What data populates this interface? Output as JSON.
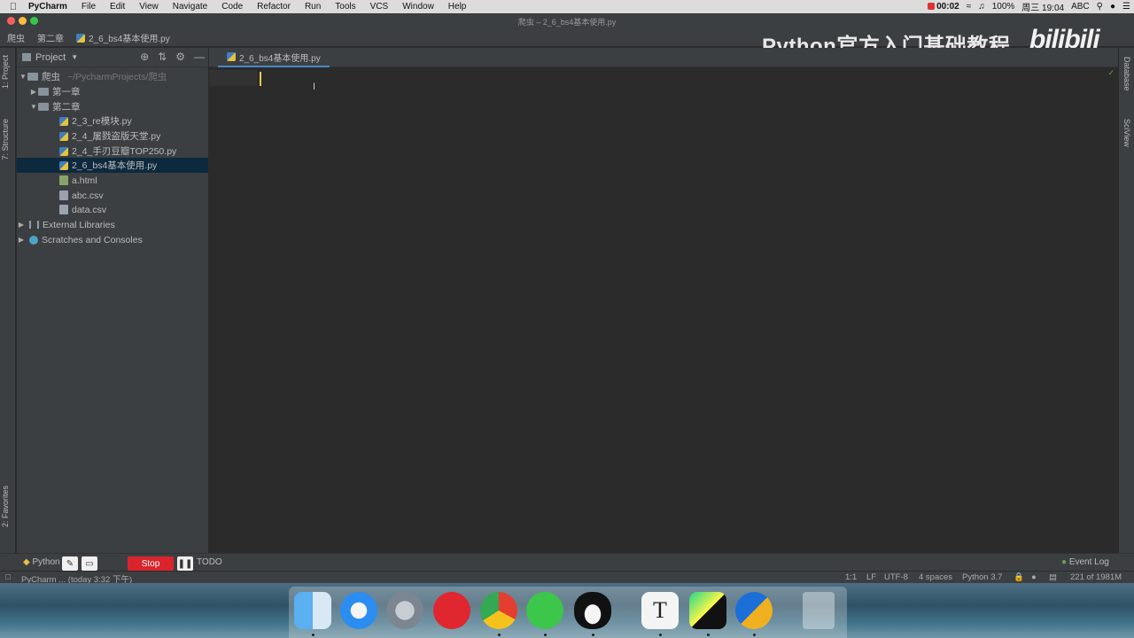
{
  "menubar": {
    "app": "PyCharm",
    "items": [
      "File",
      "Edit",
      "View",
      "Navigate",
      "Code",
      "Refactor",
      "Run",
      "Tools",
      "VCS",
      "Window",
      "Help"
    ],
    "recording_time": "00:02",
    "battery": "100%",
    "clock": "周三 19:04",
    "input_method": "ABC"
  },
  "window": {
    "title": "爬虫 – 2_6_bs4基本使用.py"
  },
  "breadcrumb": {
    "items": [
      "爬虫",
      "第二章",
      "2_6_bs4基本使用.py"
    ]
  },
  "watermark": {
    "text": "Python官方入门基础教程",
    "brand": "bilibili"
  },
  "left_strip": {
    "project_tab": "1: Project",
    "structure_tab": "7: Structure",
    "favorites_tab": "2: Favorites"
  },
  "right_strip": {
    "database_tab": "Database",
    "sciview_tab": "SciView"
  },
  "project_panel": {
    "header_label": "Project",
    "tree": [
      {
        "label": "爬虫",
        "suffix": "~/PycharmProjects/爬虫",
        "level": 0,
        "kind": "folder",
        "expanded": true
      },
      {
        "label": "第一章",
        "level": 1,
        "kind": "folder",
        "expanded": false
      },
      {
        "label": "第二章",
        "level": 1,
        "kind": "folder",
        "expanded": true
      },
      {
        "label": "2_3_re模块.py",
        "level": 2,
        "kind": "py"
      },
      {
        "label": "2_4_屠戮盗版天堂.py",
        "level": 2,
        "kind": "py"
      },
      {
        "label": "2_4_手刃豆瓣TOP250.py",
        "level": 2,
        "kind": "py"
      },
      {
        "label": "2_6_bs4基本使用.py",
        "level": 2,
        "kind": "py",
        "selected": true
      },
      {
        "label": "a.html",
        "level": 2,
        "kind": "html"
      },
      {
        "label": "abc.csv",
        "level": 2,
        "kind": "csv"
      },
      {
        "label": "data.csv",
        "level": 2,
        "kind": "csv"
      },
      {
        "label": "External Libraries",
        "level": 0,
        "kind": "lib",
        "expanded": false
      },
      {
        "label": "Scratches and Consoles",
        "level": 0,
        "kind": "scratch",
        "expanded": false
      }
    ]
  },
  "editor": {
    "active_tab": "2_6_bs4基本使用.py"
  },
  "bottom_tools": {
    "python_console": "Python",
    "todo": "TODO",
    "event_log": "Event Log",
    "stop_label": "Stop"
  },
  "statusbar": {
    "message": "PyCharm ... (today 3:32 下午)",
    "position": "1:1",
    "line_sep": "LF",
    "encoding": "UTF-8",
    "indent": "4 spaces",
    "interpreter": "Python 3.7",
    "memory": "221 of 1981M"
  },
  "colors": {
    "ide_bg": "#2b2b2b",
    "panel_bg": "#3c3f41",
    "selection": "#0d293e",
    "caret": "#e6c84a",
    "stop_red": "#d9242c"
  }
}
